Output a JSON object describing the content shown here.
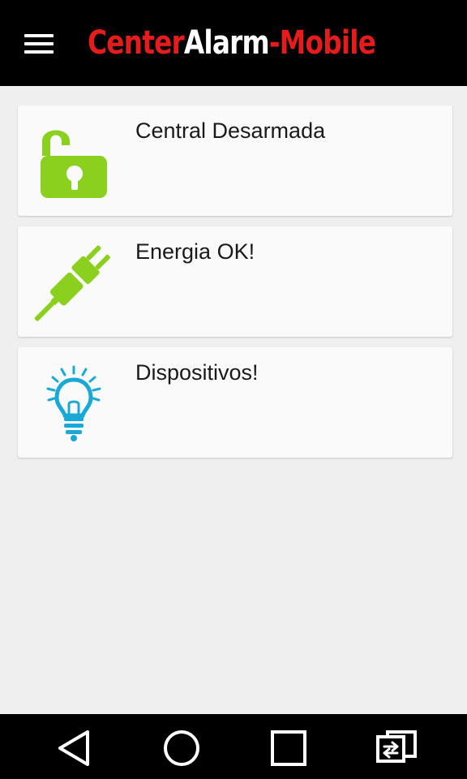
{
  "app": {
    "title_part1": "Center",
    "title_part2": "Alarm",
    "title_part3": "-Mobile",
    "accent_color": "#e41c1c"
  },
  "appbar": {
    "menu_icon": "hamburger-menu-icon"
  },
  "cards": [
    {
      "label": "Central Desarmada",
      "icon": "unlocked-padlock-icon",
      "icon_color": "#8cd01f"
    },
    {
      "label": "Energia OK!",
      "icon": "power-plug-icon",
      "icon_color": "#8cd01f"
    },
    {
      "label": "Dispositivos!",
      "icon": "light-bulb-icon",
      "icon_color": "#1aa9d6"
    }
  ],
  "navbar": {
    "back_icon": "back-triangle-icon",
    "home_icon": "home-circle-icon",
    "recents_icon": "recents-square-icon",
    "switch_icon": "switch-apps-icon"
  }
}
